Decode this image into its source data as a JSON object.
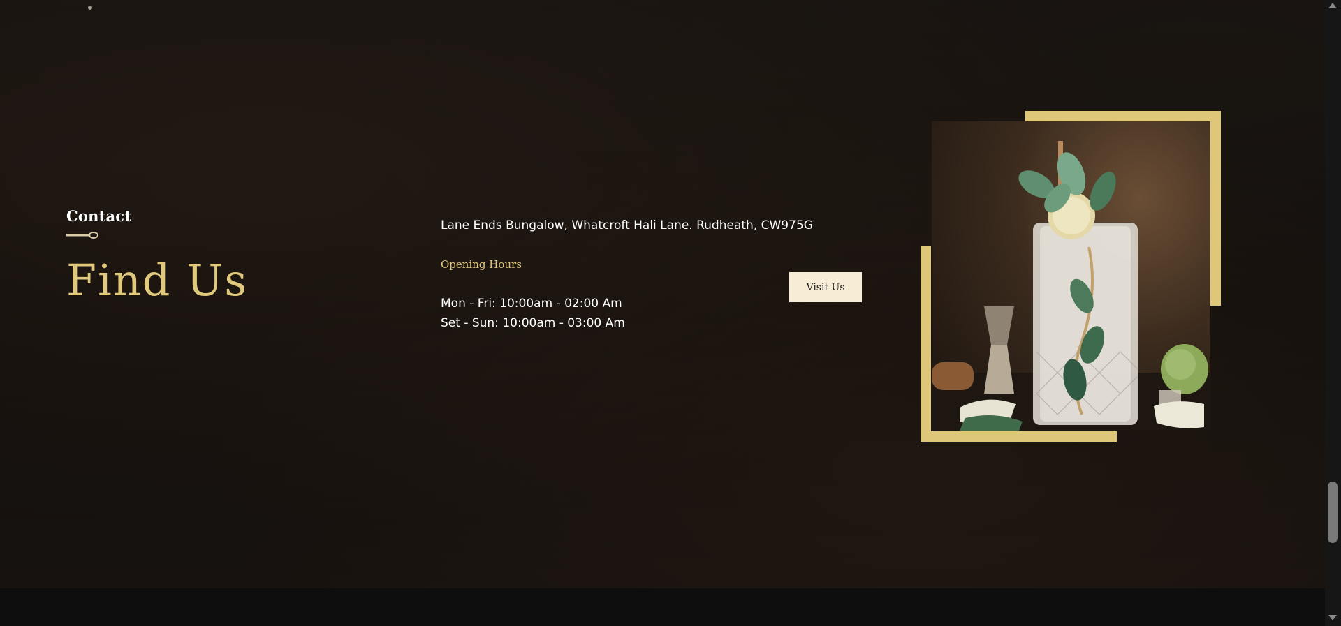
{
  "contact": {
    "eyebrow": "Contact",
    "title": "Find Us",
    "address": "Lane Ends Bungalow, Whatcroft Hali Lane. Rudheath, CW975G",
    "hours_heading": "Opening Hours",
    "hours": [
      "Mon - Fri: 10:00am - 02:00 Am",
      "Set - Sun: 10:00am - 03:00 Am"
    ],
    "button_label": "Visit Us"
  },
  "icons": {
    "divider": "spoon-icon",
    "photo": "mojito-cocktail-image"
  },
  "colors": {
    "accent_gold": "#e0c87d",
    "frame_gold": "#dfc77a",
    "button_bg": "#f7ecd5",
    "background": "#141110"
  }
}
